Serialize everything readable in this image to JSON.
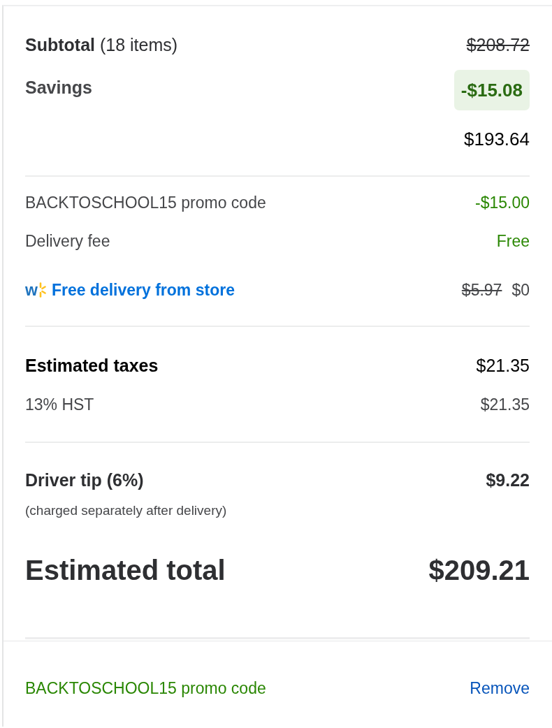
{
  "summary": {
    "subtotal": {
      "label": "**Subtotal** (18 items)",
      "amount": "$208.72",
      "struck": true
    },
    "savings": {
      "label": "Savings",
      "amount": "-$15.08"
    },
    "after_savings": "$193.64"
  },
  "charges": [
    {
      "kind": "line",
      "label": "BACKTOSCHOOL15 promo code",
      "amount": "-$15.00",
      "credit": true
    },
    {
      "kind": "line",
      "label": "Delivery fee",
      "amount": "Free",
      "credit": true
    },
    {
      "kind": "perk",
      "logo_letter": "w",
      "label": "Free delivery from store",
      "old_amount": "$5.97",
      "amount": "$0"
    }
  ],
  "taxes": {
    "label": "Estimated taxes",
    "amount": "$21.35",
    "lines": [
      {
        "label": "13% HST",
        "amount": "$21.35"
      }
    ]
  },
  "tip": {
    "label": "Driver tip (6%)",
    "amount": "$9.22",
    "note": "(charged separately after delivery)"
  },
  "total": {
    "label": "Estimated total",
    "amount": "$209.21"
  },
  "applied_promo": {
    "label": "BACKTOSCHOOL15 promo code",
    "action": "Remove"
  }
}
